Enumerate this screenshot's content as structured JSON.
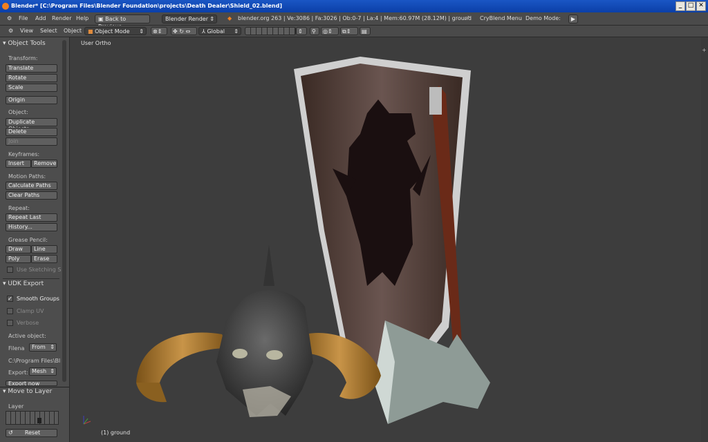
{
  "window": {
    "title": "Blender* [C:\\Program Files\\Blender Foundation\\projects\\Death Dealer\\Shield_02.blend]",
    "buttons": [
      "_",
      "□",
      "✕"
    ]
  },
  "infobar": {
    "menus": [
      "File",
      "Add",
      "Render",
      "Help"
    ],
    "back_button": "Back to Previous",
    "render_engine": "Blender Render",
    "stats": "blender.org 263 | Ve:3086 | Fa:3026 | Ob:0-7 | La:4 | Mem:60.97M (28.12M) | ground",
    "cryblend_menu": "CryBlend Menu",
    "demo_mode": "Demo Mode:"
  },
  "view_header": {
    "menus": [
      "View",
      "Select",
      "Object"
    ],
    "mode": "Object Mode",
    "orientation": "Global"
  },
  "tool_shelf": {
    "panel_title": "Object Tools",
    "transform_label": "Transform:",
    "translate": "Translate",
    "rotate": "Rotate",
    "scale": "Scale",
    "origin": "Origin",
    "object_label": "Object:",
    "duplicate": "Duplicate Objects",
    "delete": "Delete",
    "join": "Join",
    "keyframes_label": "Keyframes:",
    "insert": "Insert",
    "remove": "Remove",
    "motion_paths_label": "Motion Paths:",
    "calc_paths": "Calculate Paths",
    "clear_paths": "Clear Paths",
    "repeat_label": "Repeat:",
    "repeat_last": "Repeat Last",
    "history": "History...",
    "grease_label": "Grease Pencil:",
    "draw": "Draw",
    "line": "Line",
    "poly": "Poly",
    "erase": "Erase",
    "use_sketching": "Use Sketching S",
    "udk_title": "UDK Export",
    "smooth_groups": "Smooth Groups",
    "clamp_uv": "Clamp UV",
    "verbose": "Verbose",
    "active_object": "Active object:",
    "filena": "Filena",
    "from": "From",
    "path": "C:\\Program Files\\Bl",
    "export_label": "Export:",
    "mesh": "Mesh",
    "export_now": "Export now",
    "move_to_layer": "Move to Layer",
    "layer_label": "Layer",
    "reset": "Reset"
  },
  "viewport": {
    "view_name": "User Ortho",
    "object_info": "(1) ground"
  }
}
